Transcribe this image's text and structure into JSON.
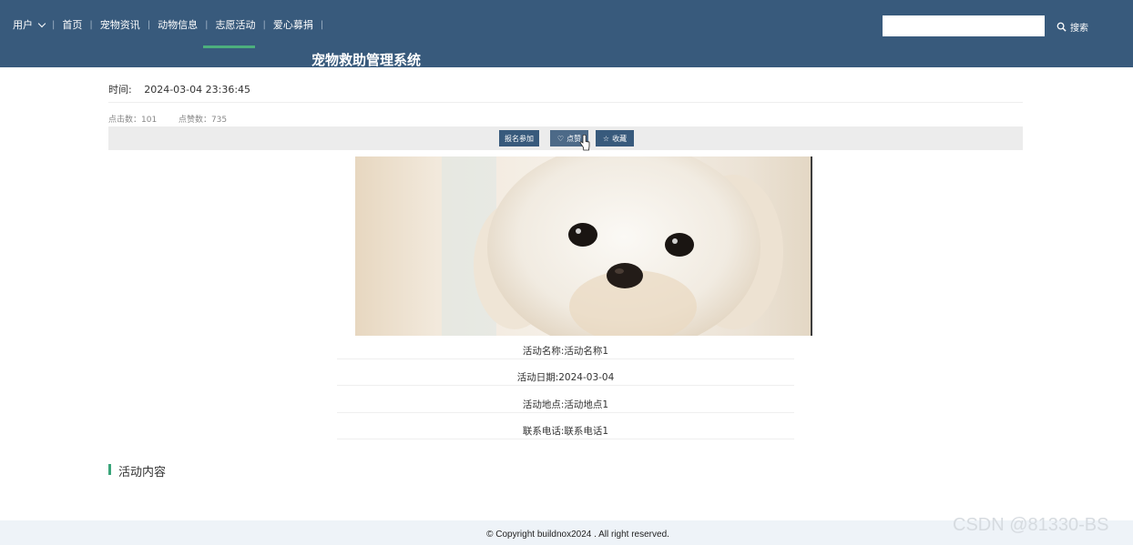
{
  "header": {
    "nav": {
      "user": "用户",
      "home": "首页",
      "pet_news": "宠物资讯",
      "animal_info": "动物信息",
      "volunteer": "志愿活动",
      "donation": "爱心募捐"
    },
    "site_title": "宠物救助管理系统",
    "search": {
      "placeholder": "",
      "button_label": "搜索"
    },
    "colors": {
      "bar": "#385a7c",
      "active_underline": "#4caf7d"
    }
  },
  "detail": {
    "time_label": "时间:",
    "time_value": "2024-03-04 23:36:45",
    "clicks": "点击数：101",
    "likes": "点赞数：735",
    "actions": {
      "signup": "报名参加",
      "like": "点赞",
      "favorite": "收藏"
    },
    "fields": [
      "活动名称:活动名称1",
      "活动日期:2024-03-04",
      "活动地点:活动地点1",
      "联系电话:联系电话1"
    ],
    "content_heading": "活动内容"
  },
  "footer": {
    "copyright": "© Copyright buildnox2024 . All right reserved."
  },
  "watermark": "CSDN @81330-BS"
}
